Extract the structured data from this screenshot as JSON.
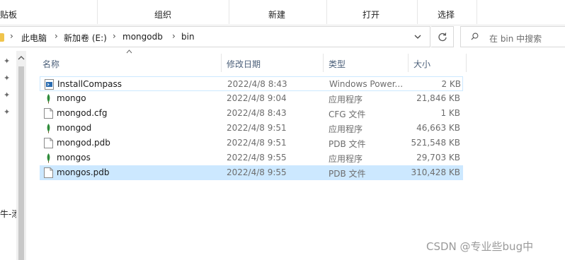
{
  "ribbon": {
    "clipboard_label": "贴板",
    "organize_label": "组织",
    "new_label": "新建",
    "open_label": "打开",
    "select_label": "选择"
  },
  "address": {
    "crumbs": [
      "此电脑",
      "新加卷 (E:)",
      "mongodb",
      "bin"
    ]
  },
  "search": {
    "placeholder": "在 bin 中搜索"
  },
  "nav": {
    "clipped_text": "牛-添"
  },
  "columns": {
    "name": "名称",
    "date": "修改日期",
    "type": "类型",
    "size": "大小"
  },
  "files": [
    {
      "name": "InstallCompass",
      "date": "2022/4/8 8:43",
      "type": "Windows Power...",
      "size": "2 KB",
      "icon": "powershell-script-icon"
    },
    {
      "name": "mongo",
      "date": "2022/4/8 9:04",
      "type": "应用程序",
      "size": "21,846 KB",
      "icon": "mongodb-leaf-icon"
    },
    {
      "name": "mongod.cfg",
      "date": "2022/4/8 8:43",
      "type": "CFG 文件",
      "size": "1 KB",
      "icon": "file-icon"
    },
    {
      "name": "mongod",
      "date": "2022/4/8 9:51",
      "type": "应用程序",
      "size": "46,663 KB",
      "icon": "mongodb-leaf-icon"
    },
    {
      "name": "mongod.pdb",
      "date": "2022/4/8 9:51",
      "type": "PDB 文件",
      "size": "521,548 KB",
      "icon": "file-icon"
    },
    {
      "name": "mongos",
      "date": "2022/4/8 9:55",
      "type": "应用程序",
      "size": "29,703 KB",
      "icon": "mongodb-leaf-icon"
    },
    {
      "name": "mongos.pdb",
      "date": "2022/4/8 9:55",
      "type": "PDB 文件",
      "size": "310,428 KB",
      "icon": "file-icon"
    }
  ],
  "watermark": "CSDN @专业些bug中",
  "colors": {
    "selection": "#cce8ff",
    "leaf": "#2e8b3a"
  }
}
